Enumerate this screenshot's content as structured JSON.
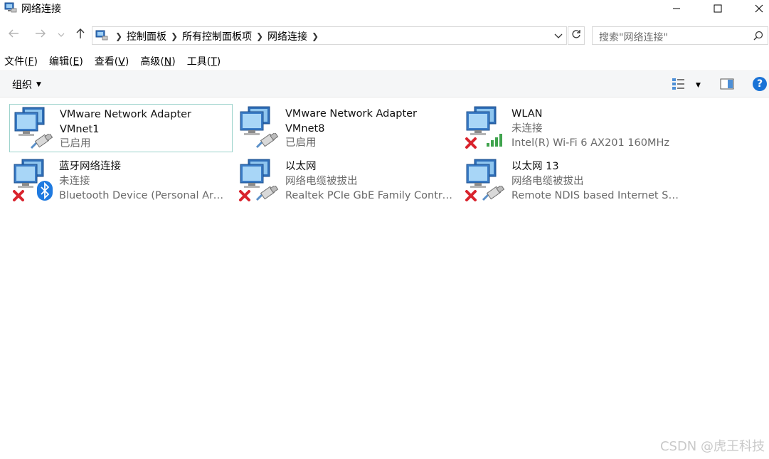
{
  "window": {
    "title": "网络连接",
    "minimize_icon": "minimize-icon",
    "maximize_icon": "maximize-icon",
    "close_icon": "close-icon"
  },
  "address_bar": {
    "breadcrumbs": [
      "控制面板",
      "所有控制面板项",
      "网络连接"
    ],
    "search_placeholder": "搜索\"网络连接\""
  },
  "menu": {
    "items": [
      {
        "label": "文件",
        "key": "F"
      },
      {
        "label": "编辑",
        "key": "E"
      },
      {
        "label": "查看",
        "key": "V"
      },
      {
        "label": "高级",
        "key": "N"
      },
      {
        "label": "工具",
        "key": "T"
      }
    ]
  },
  "toolbar": {
    "organize_label": "组织",
    "help_label": "?"
  },
  "connections": [
    {
      "name": "VMware Network Adapter VMnet1",
      "line1": "VMware Network Adapter",
      "line2": "VMnet1",
      "line3": "已启用",
      "state": "enabled",
      "badge": "ethernet-cable-icon",
      "selected": true
    },
    {
      "name": "VMware Network Adapter VMnet8",
      "line1": "VMware Network Adapter",
      "line2": "VMnet8",
      "line3": "已启用",
      "state": "enabled",
      "badge": "ethernet-cable-icon",
      "selected": false
    },
    {
      "name": "WLAN",
      "line1": "WLAN",
      "line2": "未连接",
      "line3": "Intel(R) Wi-Fi 6 AX201 160MHz",
      "state": "disconnected",
      "badge": "wifi-signal-icon",
      "selected": false
    },
    {
      "name": "蓝牙网络连接",
      "line1": "蓝牙网络连接",
      "line2": "未连接",
      "line3": "Bluetooth Device (Personal Area...",
      "state": "disconnected",
      "badge": "bluetooth-icon",
      "selected": false
    },
    {
      "name": "以太网",
      "line1": "以太网",
      "line2": "网络电缆被拔出",
      "line3": "Realtek PCIe GbE Family Control...",
      "state": "disconnected",
      "badge": "ethernet-cable-icon",
      "selected": false
    },
    {
      "name": "以太网 13",
      "line1": "以太网 13",
      "line2": "网络电缆被拔出",
      "line3": "Remote NDIS based Internet Sh...",
      "state": "disconnected",
      "badge": "ethernet-cable-icon",
      "selected": false
    }
  ],
  "watermark": "CSDN @虎王科技",
  "colors": {
    "selection_border": "#9cd3cc",
    "help_blue": "#1a73d6",
    "error_red": "#d9232d",
    "wifi_green": "#3fa34d",
    "bluetooth_blue": "#1f7ae0"
  }
}
